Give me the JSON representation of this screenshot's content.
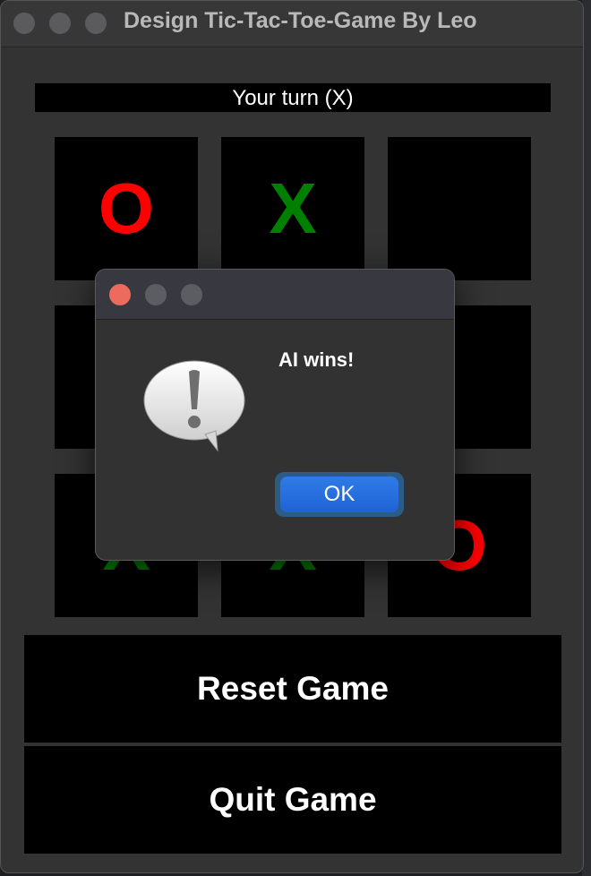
{
  "window": {
    "title": "Design Tic-Tac-Toe-Game By Leo"
  },
  "status": {
    "text": "Your turn (X)"
  },
  "board": {
    "cells": [
      "O",
      "X",
      "",
      "",
      "",
      "",
      "X",
      "X",
      "O"
    ]
  },
  "buttons": {
    "reset": "Reset Game",
    "quit": "Quit Game"
  },
  "dialog": {
    "message": "AI wins!",
    "ok_label": "OK"
  },
  "colors": {
    "o_mark": "#ff0000",
    "x_mark": "#008000",
    "ok_button": "#1f63d6",
    "close_dot": "#ec6a5e"
  },
  "icons": {
    "alert": "exclamation-speech-bubble-icon"
  }
}
